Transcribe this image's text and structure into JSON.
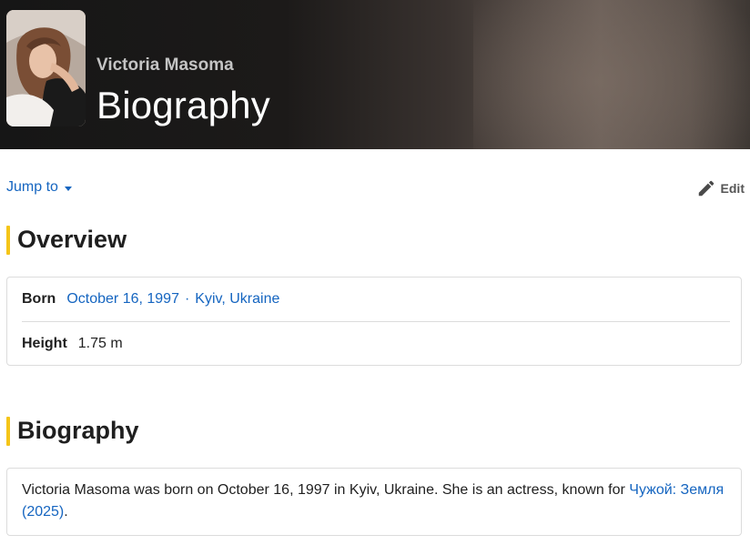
{
  "header": {
    "name": "Victoria Masoma",
    "title": "Biography"
  },
  "toolbar": {
    "jump_label": "Jump to",
    "edit_label": "Edit"
  },
  "overview": {
    "heading": "Overview",
    "born_label": "Born",
    "born_date": "October 16, 1997",
    "born_separator": "·",
    "born_place": "Kyiv, Ukraine",
    "height_label": "Height",
    "height_value": "1.75 m"
  },
  "biography": {
    "heading": "Biography",
    "text": "Victoria Masoma was born on October 16, 1997 in Kyiv, Ukraine. She is an actress, known for ",
    "link": "Чужой: Земля (2025)",
    "end": "."
  },
  "colors": {
    "accent": "#f5c518",
    "link": "#1565c0"
  },
  "icons": {
    "dropdown": "caret-down-icon",
    "edit": "pencil-icon"
  }
}
